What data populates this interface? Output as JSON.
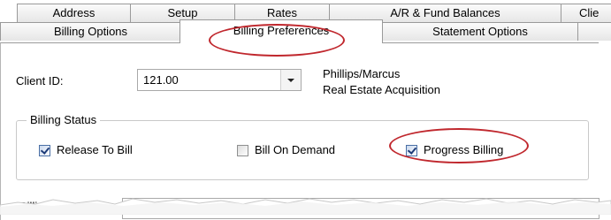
{
  "tabs_row1": [
    {
      "label": "Address"
    },
    {
      "label": "Setup"
    },
    {
      "label": "Rates"
    },
    {
      "label": "A/R & Fund Balances"
    },
    {
      "label": "Clie"
    }
  ],
  "tabs_row2": [
    {
      "label": "Billing Options"
    },
    {
      "label": "Billing Preferences",
      "active": true
    },
    {
      "label": "Statement Options"
    }
  ],
  "client": {
    "label": "Client ID:",
    "value": "121.00",
    "name": "Phillips/Marcus",
    "description": "Real Estate Acquisition"
  },
  "billing_status": {
    "title": "Billing Status",
    "release_to_bill": {
      "label": "Release To Bill",
      "checked": true
    },
    "bill_on_demand": {
      "label": "Bill On Demand",
      "checked": false
    },
    "progress_billing": {
      "label": "Progress Billing",
      "checked": true
    }
  },
  "billing_notes": {
    "label": "Billing Notes A"
  },
  "colors": {
    "highlight": "#c0272d",
    "tab_border": "#9a9a9a"
  }
}
